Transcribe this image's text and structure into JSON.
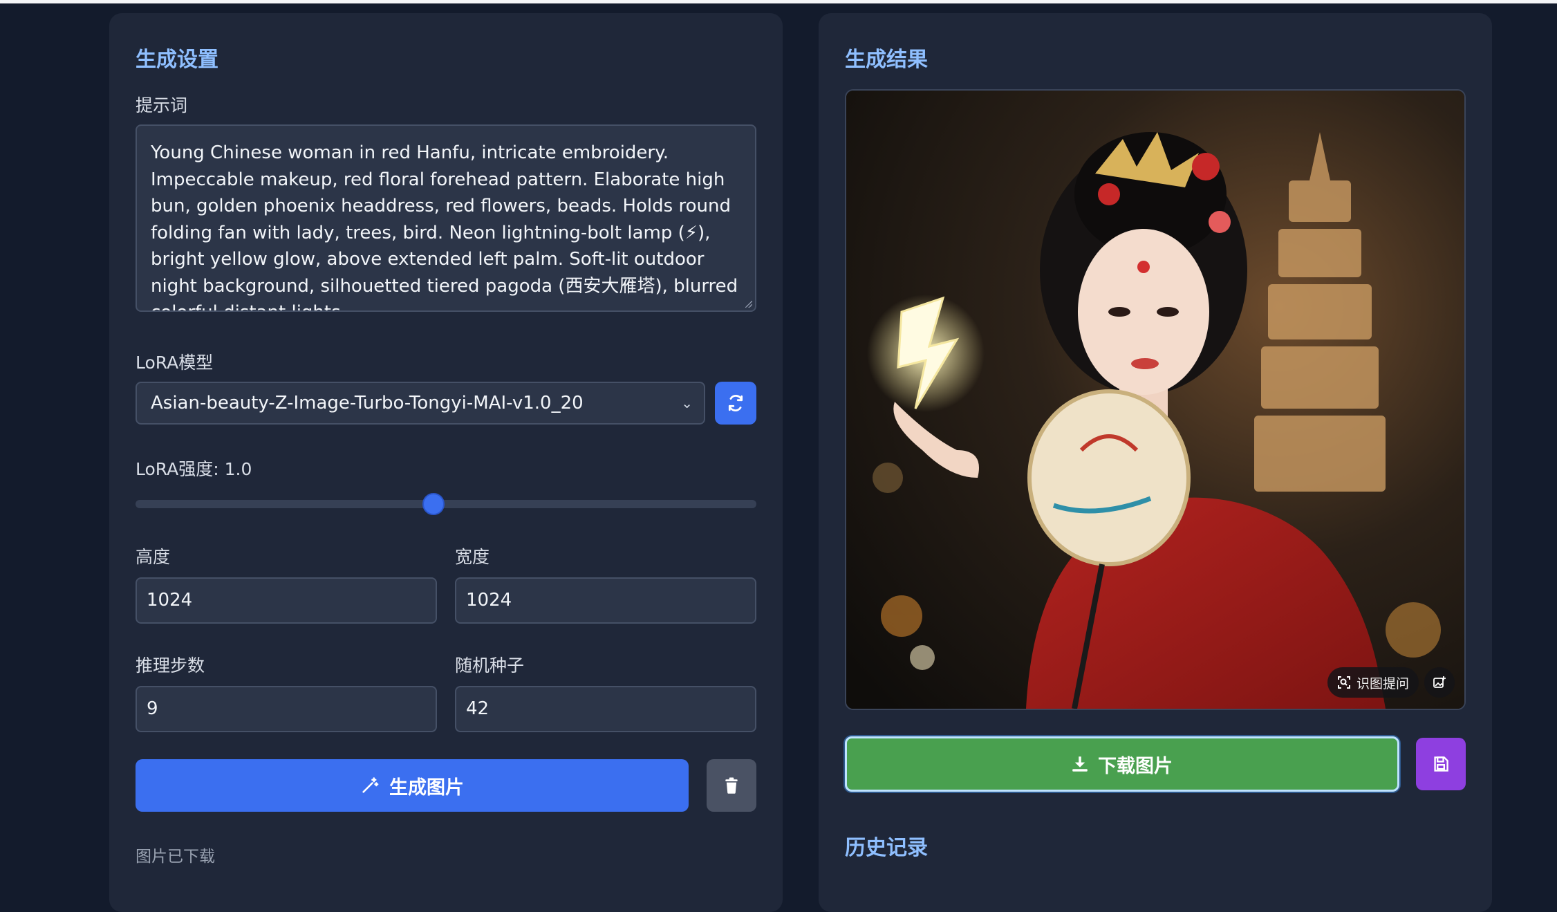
{
  "settings": {
    "title": "生成设置",
    "prompt_label": "提示词",
    "prompt_value": "Young Chinese woman in red Hanfu, intricate embroidery. Impeccable makeup, red floral forehead pattern. Elaborate high bun, golden phoenix headdress, red flowers, beads. Holds round folding fan with lady, trees, bird. Neon lightning-bolt lamp (⚡), bright yellow glow, above extended left palm. Soft-lit outdoor night background, silhouetted tiered pagoda (西安大雁塔), blurred colorful distant lights.",
    "lora_label": "LoRA模型",
    "lora_selected": "Asian-beauty-Z-Image-Turbo-Tongyi-MAI-v1.0_20",
    "lora_strength_label": "LoRA强度: 1.0",
    "lora_strength_fraction": 0.48,
    "height_label": "高度",
    "height_value": "1024",
    "width_label": "宽度",
    "width_value": "1024",
    "steps_label": "推理步数",
    "steps_value": "9",
    "seed_label": "随机种子",
    "seed_value": "42",
    "generate_label": "生成图片",
    "status_text": "图片已下载"
  },
  "result": {
    "title": "生成结果",
    "recognize_label": "识图提问",
    "download_label": "下载图片",
    "history_title": "历史记录"
  },
  "colors": {
    "accent_blue": "#3b6ff0",
    "download_green": "#49a04f",
    "save_purple": "#8e3fe0",
    "title_blue": "#8fbfff"
  },
  "icons": {
    "refresh": "refresh-icon",
    "wand": "magic-wand-icon",
    "trash": "trash-icon",
    "download": "download-icon",
    "save": "save-icon",
    "scan": "scan-icon",
    "image_edit": "image-edit-icon"
  }
}
